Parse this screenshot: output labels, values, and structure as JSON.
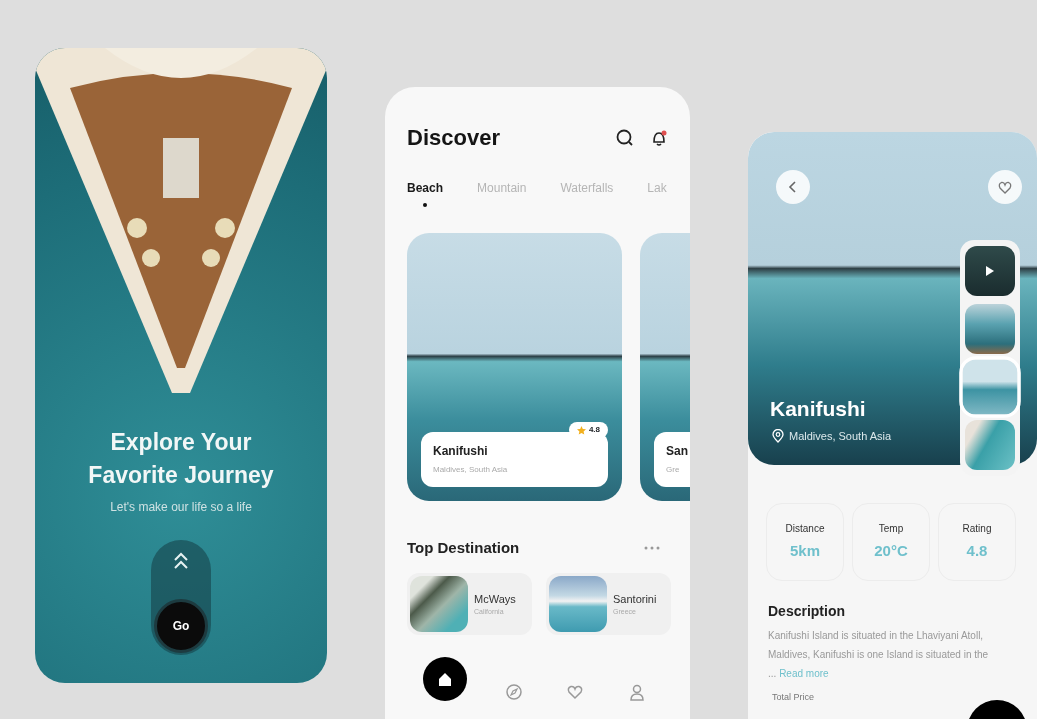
{
  "onboarding": {
    "title": "Explore Your Favorite Journey",
    "subtitle": "Let's make our life so a life",
    "go_button": "Go"
  },
  "discover": {
    "title": "Discover",
    "tabs": [
      {
        "label": "Beach",
        "selected": true
      },
      {
        "label": "Mountain",
        "selected": false
      },
      {
        "label": "Waterfalls",
        "selected": false
      },
      {
        "label": "Lak",
        "selected": false
      }
    ],
    "featured": [
      {
        "name": "Kanifushi",
        "location": "Maldives, South Asia",
        "rating": "4.8"
      },
      {
        "name": "San",
        "location": "Gre"
      }
    ],
    "top_destination": {
      "title": "Top Destination",
      "items": [
        {
          "name": "McWays",
          "location": "California"
        },
        {
          "name": "Santorini",
          "location": "Greece"
        }
      ]
    },
    "nav": [
      {
        "kind": "home",
        "selected": true
      },
      {
        "kind": "compass",
        "selected": false
      },
      {
        "kind": "heart",
        "selected": false
      },
      {
        "kind": "user",
        "selected": false
      }
    ]
  },
  "detail": {
    "name": "Kanifushi",
    "location": "Maldives, South Asia",
    "thumbnails": [
      {
        "kind": "video",
        "selected": false
      },
      {
        "kind": "photo",
        "selected": false
      },
      {
        "kind": "photo",
        "selected": true
      },
      {
        "kind": "photo",
        "selected": false
      }
    ],
    "stats": [
      {
        "label": "Distance",
        "value": "5km"
      },
      {
        "label": "Temp",
        "value": "20°C"
      },
      {
        "label": "Rating",
        "value": "4.8"
      }
    ],
    "description_title": "Description",
    "description": "Kanifushi Island is situated in the Lhaviyani Atoll, Maldives, Kanifushi is one Island is situated in the ...",
    "read_more": "Read more",
    "total_price_label": "Total Price"
  }
}
